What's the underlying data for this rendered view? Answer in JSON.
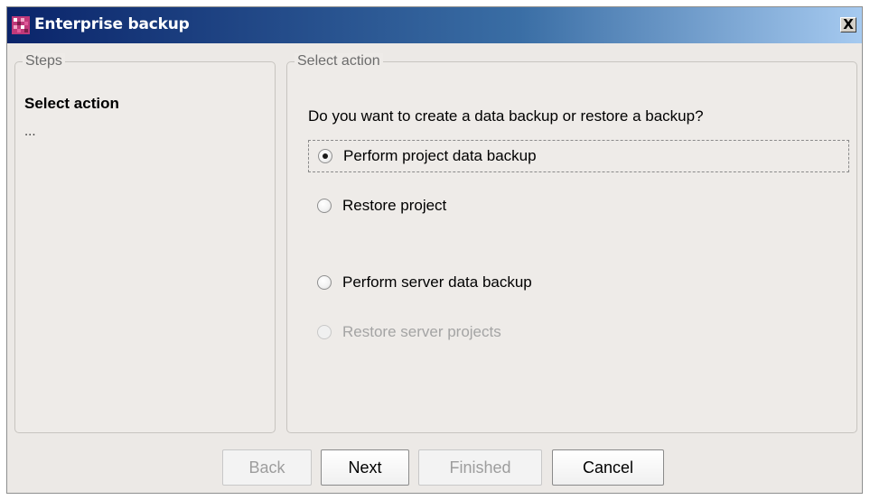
{
  "window": {
    "title": "Enterprise backup",
    "close_label": "X"
  },
  "steps": {
    "legend": "Steps",
    "current": "Select action",
    "more": "..."
  },
  "select_action": {
    "legend": "Select action",
    "question": "Do you want to create a data backup or restore a backup?",
    "options": [
      {
        "label": "Perform project data backup",
        "selected": true,
        "enabled": true
      },
      {
        "label": "Restore project",
        "selected": false,
        "enabled": true
      },
      {
        "label": "Perform server data backup",
        "selected": false,
        "enabled": true
      },
      {
        "label": "Restore server projects",
        "selected": false,
        "enabled": false
      }
    ]
  },
  "buttons": {
    "back": "Back",
    "next": "Next",
    "finished": "Finished",
    "cancel": "Cancel"
  }
}
